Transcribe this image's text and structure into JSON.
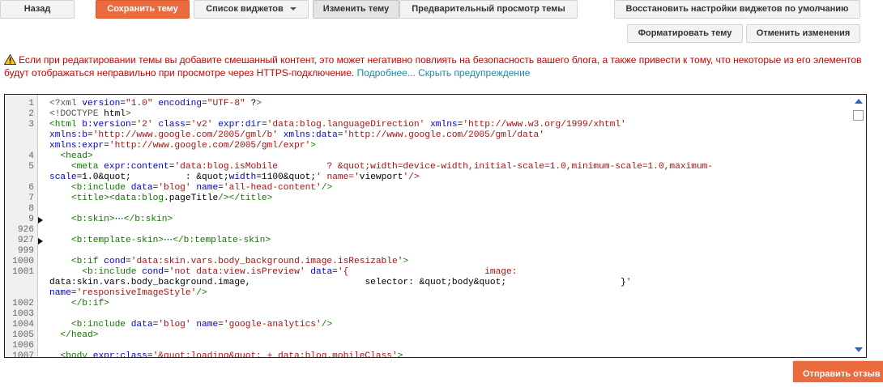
{
  "toolbar": {
    "back_label": "Назад",
    "save_label": "Сохранить тему",
    "widgets_label": "Список виджетов",
    "edit_label": "Изменить тему",
    "preview_label": "Предварительный просмотр темы",
    "restore_label": "Восстановить настройки виджетов по умолчанию",
    "format_label": "Форматировать тему",
    "undo_label": "Отменить изменения"
  },
  "warning": {
    "text": "Если при редактировании темы вы добавите смешанный контент, это может негативно повлиять на безопасность вашего блога, а также привести к тому, что некоторые из его элементов будут отображаться неправильно при просмотре через HTTPS-подключение.",
    "more_link": "Подробнее...",
    "hide_link": "Скрыть предупреждение",
    "icon": "warning-triangle-icon"
  },
  "editor": {
    "line_numbers": [
      "1",
      "2",
      "3",
      "",
      "",
      "4",
      "5",
      "",
      "6",
      "7",
      "8",
      "9",
      "926",
      "927",
      "999",
      "1000",
      "1001",
      "",
      "",
      "1002",
      "1003",
      "1004",
      "1005",
      "1006",
      "1007"
    ],
    "code": [
      "<?xml version=\"1.0\" encoding=\"UTF-8\" ?>",
      "<!DOCTYPE html>",
      "<html b:version='2' class='v2' expr:dir='data:blog.languageDirection' xmlns='http://www.w3.org/1999/xhtml'",
      "xmlns:b='http://www.google.com/2005/gml/b' xmlns:data='http://www.google.com/2005/gml/data'",
      "xmlns:expr='http://www.google.com/2005/gml/expr'>",
      "  <head>",
      "    <meta expr:content='data:blog.isMobile         ? &quot;width=device-width,initial-scale=1.0,minimum-scale=1.0,maximum-",
      "scale=1.0&quot;          : &quot;width=1100&quot;' name='viewport'/>",
      "    <b:include data='blog' name='all-head-content'/>",
      "    <title><data:blog.pageTitle/></title>",
      "",
      "    <b:skin>⋯</b:skin>",
      "",
      "    <b:template-skin>⋯</b:template-skin>",
      "",
      "    <b:if cond='data:skin.vars.body_background.image.isResizable'>",
      "      <b:include cond='not data:view.isPreview' data='{                         image:",
      "data:skin.vars.body_background.image,                     selector: &quot;body&quot;                     }'",
      "name='responsiveImageStyle'/>",
      "    </b:if>",
      "",
      "    <b:include data='blog' name='google-analytics'/>",
      "  </head>",
      "",
      "  <body expr:class='&quot;loading&quot; + data:blog.mobileClass'>"
    ],
    "folded_lines": [
      "9",
      "927"
    ]
  },
  "feedback_label": "Отправить отзыв"
}
